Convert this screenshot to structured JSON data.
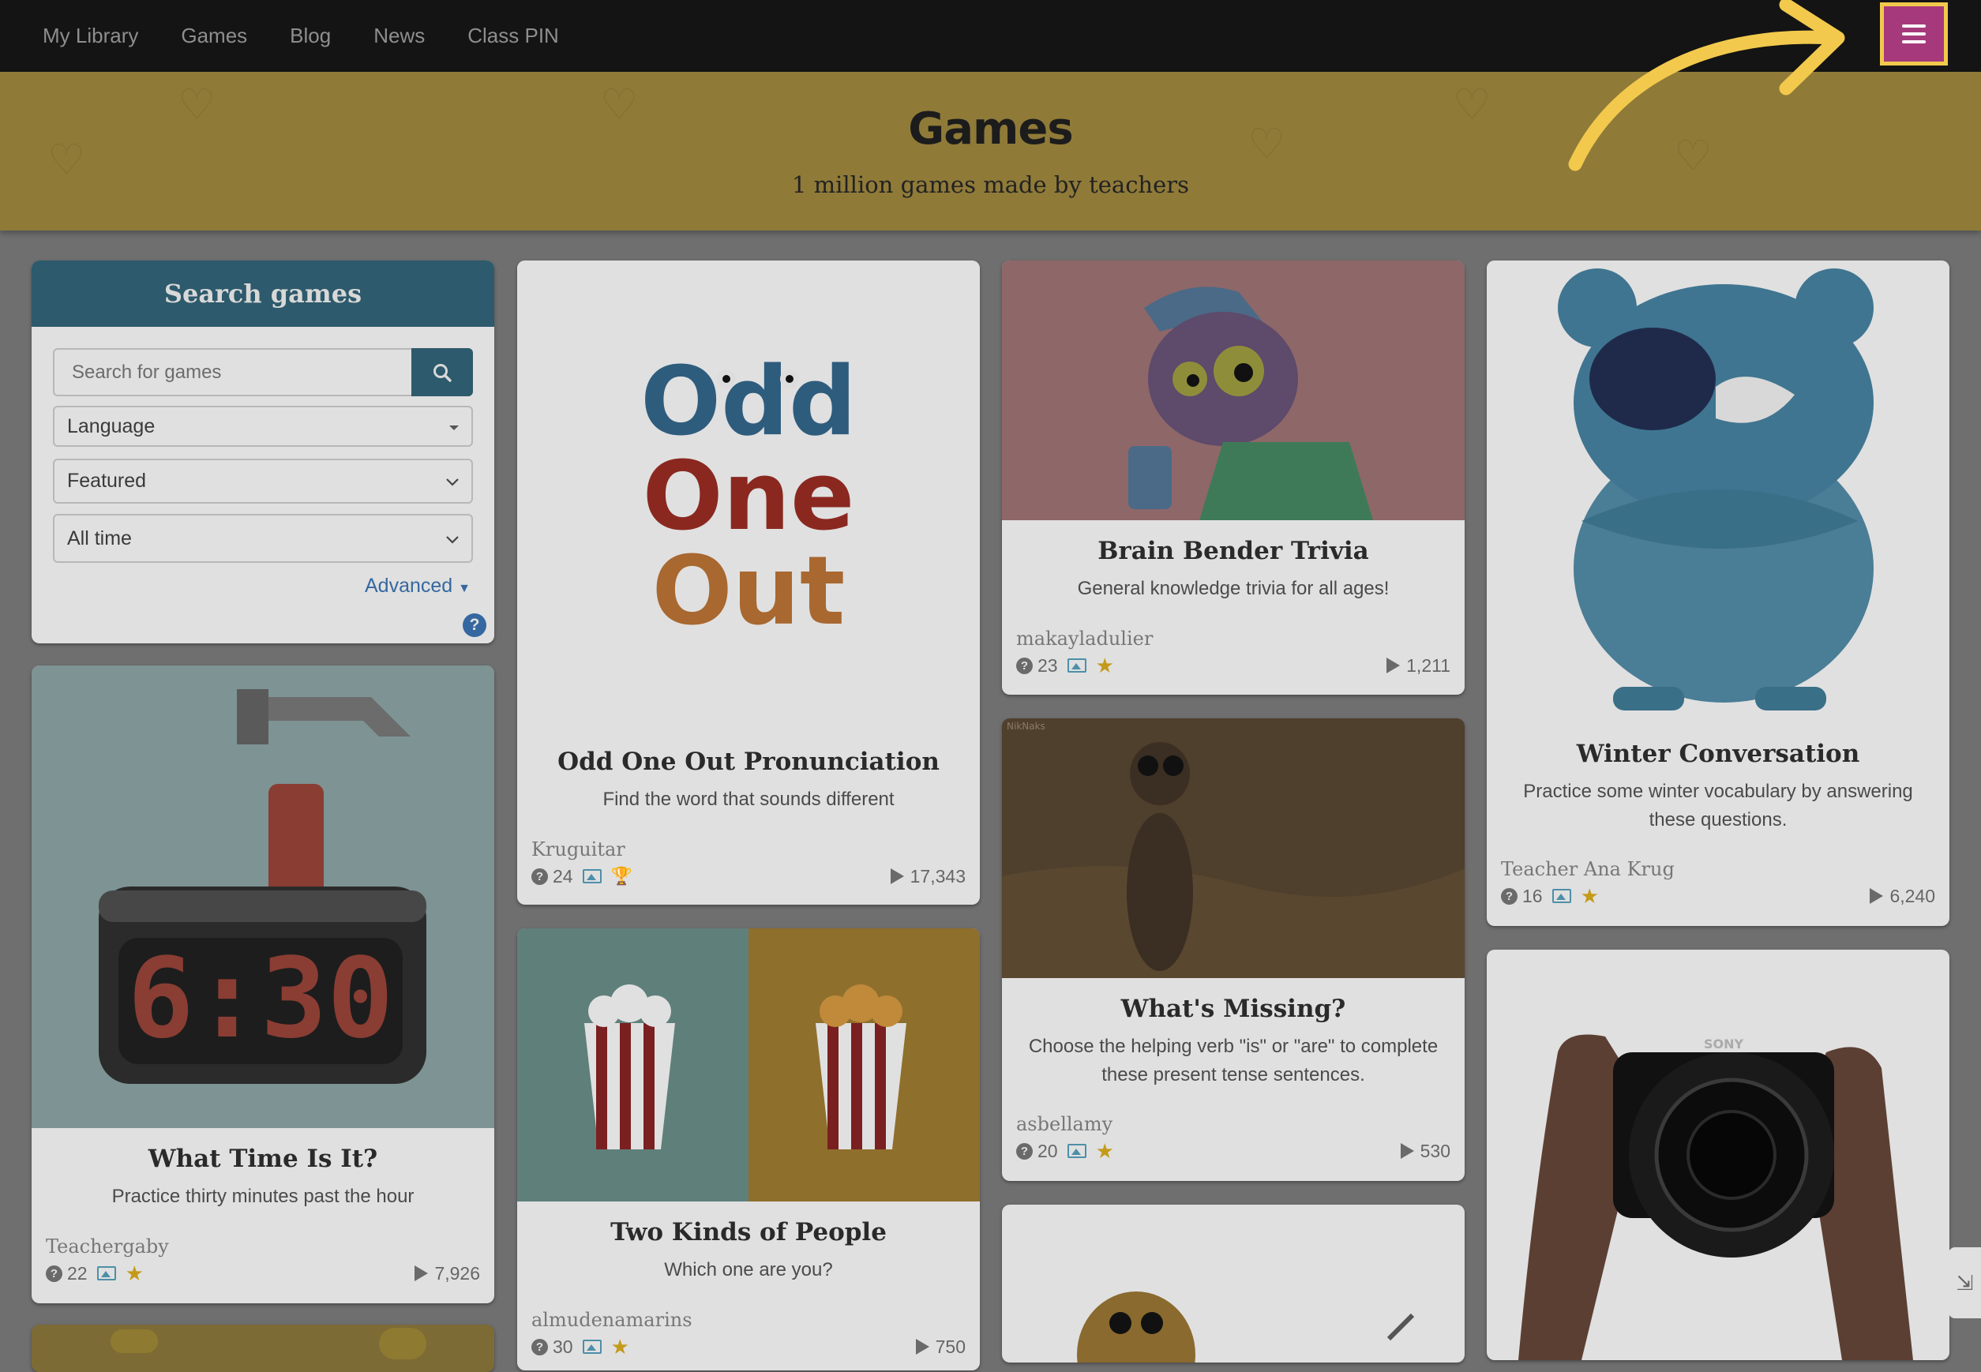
{
  "nav": {
    "links": [
      "My Library",
      "Games",
      "Blog",
      "News",
      "Class PIN"
    ],
    "menu_icon": "hamburger-menu-icon",
    "highlight_color": "#f2c94c",
    "menu_color": "#a6397c"
  },
  "banner": {
    "title": "Games",
    "subtitle": "1 million games made by teachers"
  },
  "search": {
    "heading": "Search games",
    "placeholder": "Search for games",
    "language": "Language",
    "sort": "Featured",
    "timeframe": "All time",
    "advanced": "Advanced",
    "help": "?"
  },
  "cards": [
    {
      "title": "What Time Is It?",
      "description": "Practice thirty minutes past the hour",
      "author": "Teachergaby",
      "questions": "22",
      "plays": "7,926",
      "badge": "star"
    },
    {
      "title": "Odd One Out Pronunciation",
      "description": "Find the word that sounds different",
      "author": "Kruguitar",
      "questions": "24",
      "plays": "17,343",
      "badge": "trophy",
      "thumb_text": [
        "Odd",
        "One",
        "Out"
      ]
    },
    {
      "title": "Two Kinds of People",
      "description": "Which one are you?",
      "author": "almudenamarins",
      "questions": "30",
      "plays": "750",
      "badge": "star"
    },
    {
      "title": "Brain Bender Trivia",
      "description": "General knowledge trivia for all ages!",
      "author": "makayladulier",
      "questions": "23",
      "plays": "1,211",
      "badge": "star"
    },
    {
      "title": "What's Missing?",
      "description": "Choose the helping verb \"is\" or \"are\" to complete these present tense sentences.",
      "author": "asbellamy",
      "questions": "20",
      "plays": "530",
      "badge": "star",
      "thumb_credit": "NikNaks"
    },
    {
      "title": "Winter Conversation",
      "description": "Practice some winter vocabulary by answering these questions.",
      "author": "Teacher Ana Krug",
      "questions": "16",
      "plays": "6,240",
      "badge": "star"
    }
  ],
  "camera_brand": "SONY"
}
